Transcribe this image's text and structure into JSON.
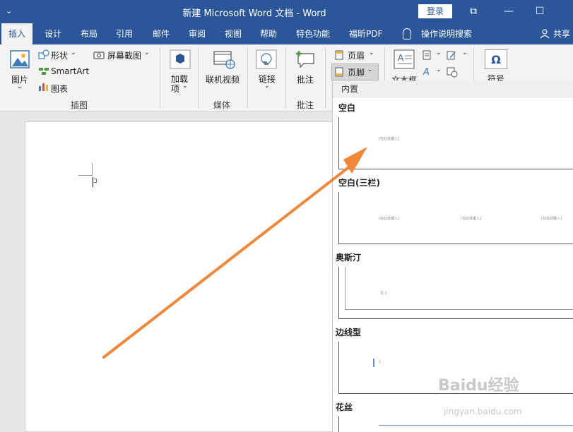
{
  "titlebar": {
    "quick_access": "⌄",
    "title": "新建 Microsoft Word 文档  -  Word",
    "login": "登录",
    "restore_icon": "⧉",
    "minimize_icon": "—",
    "maximize_icon": "☐"
  },
  "tabs": [
    {
      "label": "插入"
    },
    {
      "label": "设计"
    },
    {
      "label": "布局"
    },
    {
      "label": "引用"
    },
    {
      "label": "邮件"
    },
    {
      "label": "审阅"
    },
    {
      "label": "视图"
    },
    {
      "label": "帮助"
    },
    {
      "label": "特色功能"
    },
    {
      "label": "福昕PDF"
    },
    {
      "label": "操作说明搜索"
    },
    {
      "label": "共享"
    }
  ],
  "ribbon": {
    "illustrations": {
      "picture": "图片",
      "shapes": "形状",
      "smartart": "SmartArt",
      "chart": "图表",
      "screenshot": "屏幕截图",
      "group_label": "插图"
    },
    "addins": {
      "label_line1": "加载",
      "label_line2": "项"
    },
    "media": {
      "online_video": "联机视频",
      "group_label": "媒体"
    },
    "links": {
      "label": "链接"
    },
    "comments": {
      "comment": "批注",
      "group_label": "批注"
    },
    "header_footer": {
      "header": "页眉",
      "footer": "页脚"
    },
    "text": {
      "textbox": "文本框"
    },
    "symbols": {
      "symbol": "符号",
      "omega": "Ω"
    },
    "dropdown_caret": "⌄"
  },
  "gallery": {
    "section": "内置",
    "items": [
      {
        "title": "空白",
        "placeholder": "[在此处键入]"
      },
      {
        "title": "空白(三栏)",
        "placeholder": "[在此处键入]"
      },
      {
        "title": "奥斯汀",
        "placeholder": "页 1"
      },
      {
        "title": "边线型",
        "placeholder": "1"
      },
      {
        "title": "花丝",
        "placeholder": ""
      }
    ]
  },
  "watermark": {
    "logo": "Baidu经验",
    "url": "jingyan.baidu.com"
  },
  "colors": {
    "brand": "#2b579a",
    "arrow": "#f0883a",
    "ribbon_bg": "#f3f3f3"
  }
}
